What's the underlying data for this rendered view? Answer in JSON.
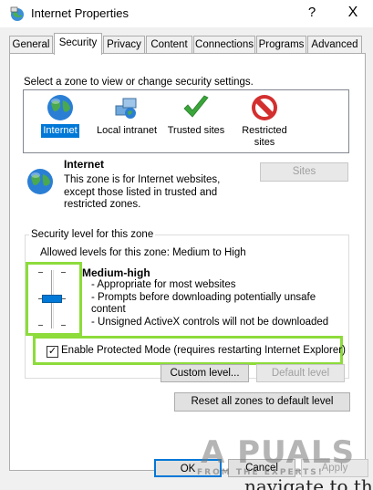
{
  "window": {
    "title": "Internet Properties",
    "help": "?",
    "close": "X"
  },
  "tabs": [
    {
      "label": "General"
    },
    {
      "label": "Security",
      "active": true
    },
    {
      "label": "Privacy"
    },
    {
      "label": "Content"
    },
    {
      "label": "Connections"
    },
    {
      "label": "Programs"
    },
    {
      "label": "Advanced"
    }
  ],
  "security": {
    "zone_prompt": "Select a zone to view or change security settings.",
    "zones": [
      {
        "label": "Internet",
        "icon": "globe-icon",
        "selected": true
      },
      {
        "label": "Local intranet",
        "icon": "intranet-icon"
      },
      {
        "label": "Trusted sites",
        "icon": "checkmark-icon"
      },
      {
        "label": "Restricted sites",
        "icon": "restricted-icon"
      }
    ],
    "zone_info": {
      "title": "Internet",
      "description": "This zone is for Internet websites, except those listed in trusted and restricted zones."
    },
    "sites_button": "Sites",
    "level_group_label": "Security level for this zone",
    "allowed_levels": "Allowed levels for this zone: Medium to High",
    "level_name": "Medium-high",
    "level_points": [
      "- Appropriate for most websites",
      "- Prompts before downloading potentially unsafe",
      "content",
      "- Unsigned ActiveX controls will not be downloaded"
    ],
    "protected_mode": {
      "label": "Enable Protected Mode (requires restarting Internet Explorer)",
      "checked": true,
      "checkmark": "✓"
    },
    "custom_level_button": "Custom level...",
    "default_level_button": "Default level",
    "reset_button": "Reset all zones to default level"
  },
  "footer": {
    "ok": "OK",
    "cancel": "Cancel",
    "apply": "Apply"
  },
  "watermark": {
    "text": "A PUALS",
    "subtext": "FROM THE EXPERTS!"
  },
  "background_text": "navigate to the",
  "colors": {
    "selection": "#0078d7",
    "highlight": "#8ddc3b"
  }
}
